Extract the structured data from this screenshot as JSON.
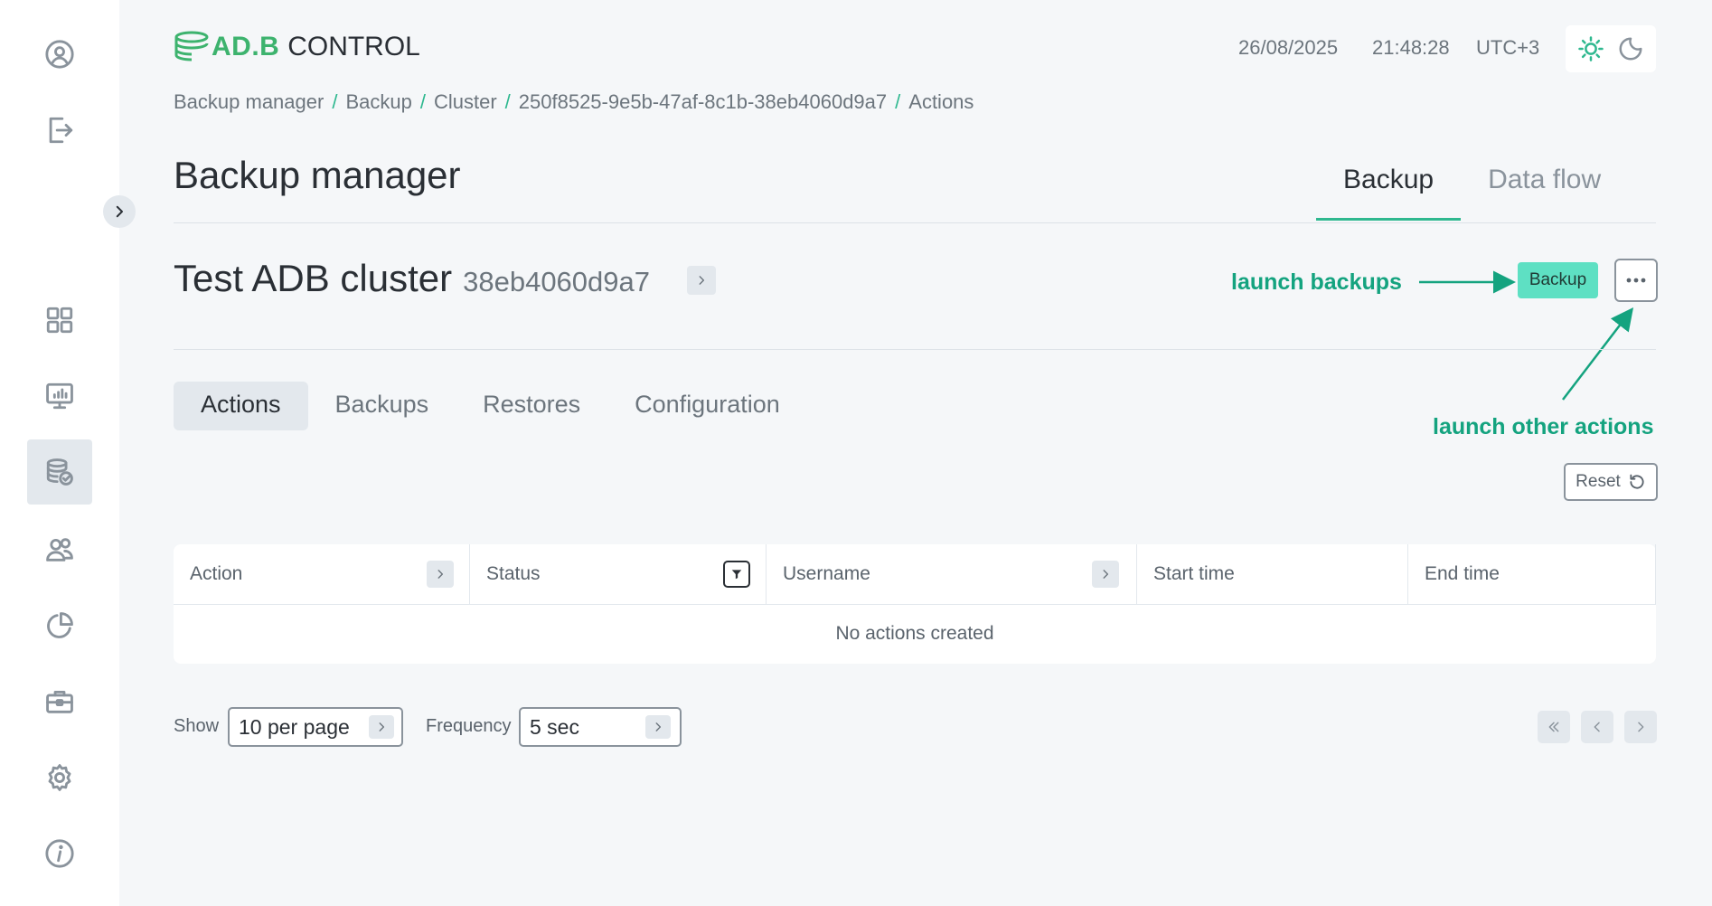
{
  "app": {
    "logo": {
      "part1": "AD.B",
      "part2": "CONTROL"
    }
  },
  "header": {
    "date": "26/08/2025",
    "time": "21:48:28",
    "timezone": "UTC+3",
    "theme_icons": [
      "sun-icon",
      "moon-icon"
    ]
  },
  "sidebar": {
    "items": [
      {
        "icon": "user-icon"
      },
      {
        "icon": "logout-icon"
      },
      {
        "icon": "dashboard-icon"
      },
      {
        "icon": "monitoring-icon"
      },
      {
        "icon": "backup-manager-icon",
        "active": true
      },
      {
        "icon": "users-icon"
      },
      {
        "icon": "pie-chart-icon"
      },
      {
        "icon": "toolbox-icon"
      },
      {
        "icon": "settings-icon"
      },
      {
        "icon": "info-icon"
      }
    ]
  },
  "breadcrumb": [
    "Backup manager",
    "Backup",
    "Cluster",
    "250f8525-9e5b-47af-8c1b-38eb4060d9a7",
    "Actions"
  ],
  "page": {
    "title": "Backup manager",
    "tabs": [
      {
        "label": "Backup",
        "active": true
      },
      {
        "label": "Data flow",
        "active": false
      }
    ]
  },
  "cluster": {
    "name": "Test ADB cluster",
    "id_short": "38eb4060d9a7"
  },
  "actions": {
    "backup_button": "Backup"
  },
  "annotations": {
    "launch_backups": "launch backups",
    "launch_other": "launch other actions"
  },
  "sub_tabs": [
    {
      "label": "Actions",
      "active": true
    },
    {
      "label": "Backups",
      "active": false
    },
    {
      "label": "Restores",
      "active": false
    },
    {
      "label": "Configuration",
      "active": false
    }
  ],
  "reset_label": "Reset",
  "table": {
    "columns": [
      "Action",
      "Status",
      "Username",
      "Start time",
      "End time"
    ],
    "empty_message": "No actions created"
  },
  "footer": {
    "show_label": "Show",
    "per_page": "10 per page",
    "frequency_label": "Frequency",
    "frequency": "5 sec"
  },
  "colors": {
    "accent": "#2eb88f",
    "annotation": "#14a37f",
    "backup_button": "#5ee0c3"
  }
}
